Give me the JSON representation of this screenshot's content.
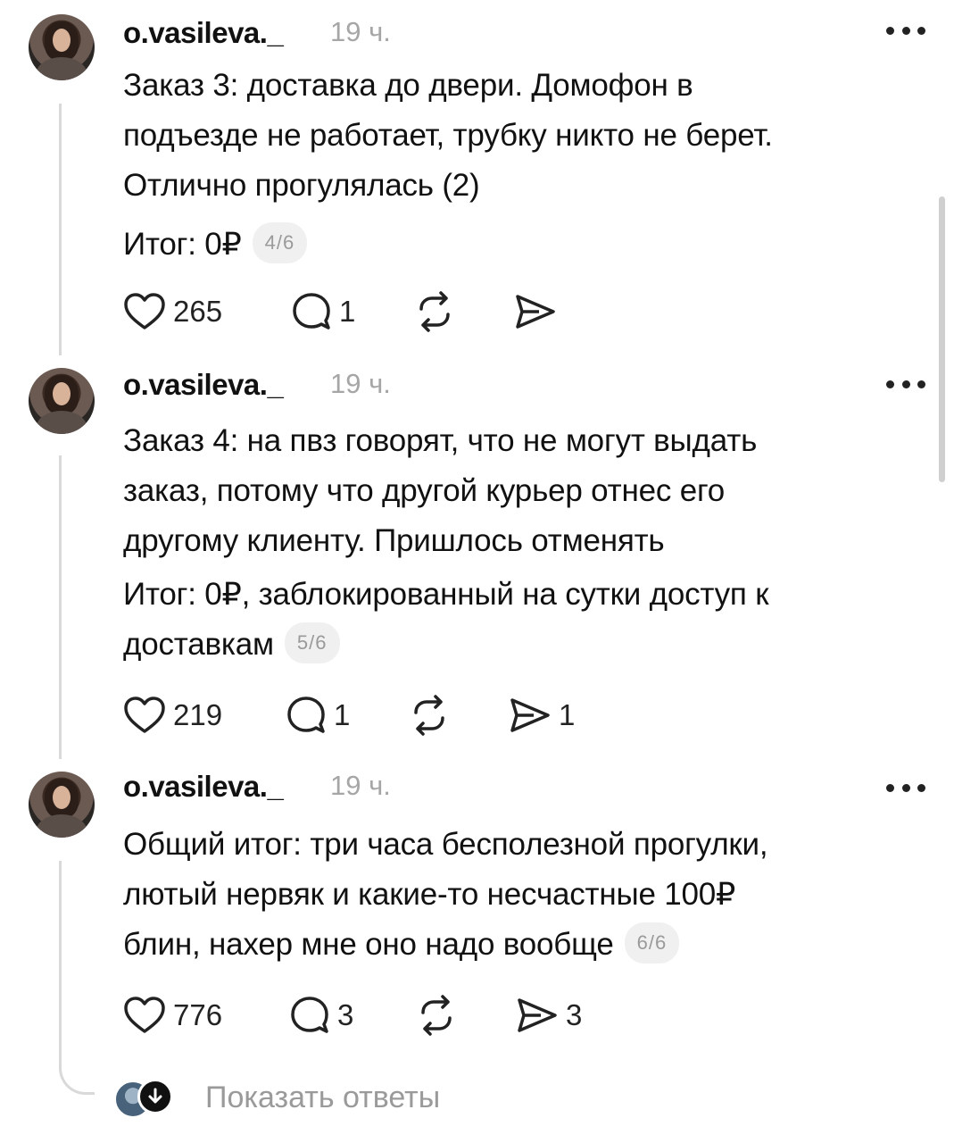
{
  "posts": [
    {
      "username": "o.vasileva._",
      "time": "19 ч.",
      "lines": [
        "Заказ 3: доставка до двери. Домофон в",
        "подъезде не работает, трубку никто не берет.",
        "Отлично прогулялась (2)",
        "Итог: 0₽"
      ],
      "page_badge": "4/6",
      "likes": "265",
      "comments": "1",
      "reposts": "",
      "shares": ""
    },
    {
      "username": "o.vasileva._",
      "time": "19 ч.",
      "lines": [
        "Заказ 4: на пвз говорят, что не могут выдать",
        "заказ, потому что другой курьер отнес его",
        "другому клиенту. Пришлось отменять",
        "Итог: 0₽, заблокированный на сутки доступ к",
        "доставкам"
      ],
      "page_badge": "5/6",
      "likes": "219",
      "comments": "1",
      "reposts": "",
      "shares": "1"
    },
    {
      "username": "o.vasileva._",
      "time": "19 ч.",
      "lines": [
        "Общий итог: три часа бесполезной прогулки,",
        "лютый нервяк и какие-то несчастные 100₽",
        "блин, нахер мне оно надо вообще"
      ],
      "page_badge": "6/6",
      "likes": "776",
      "comments": "3",
      "reposts": "",
      "shares": "3"
    }
  ],
  "show_replies_label": "Показать ответы",
  "icons": {
    "like": "heart-icon",
    "comment": "comment-bubble-icon",
    "repost": "repost-icon",
    "share": "send-icon",
    "more": "more-icon",
    "expand": "arrow-down-icon"
  }
}
